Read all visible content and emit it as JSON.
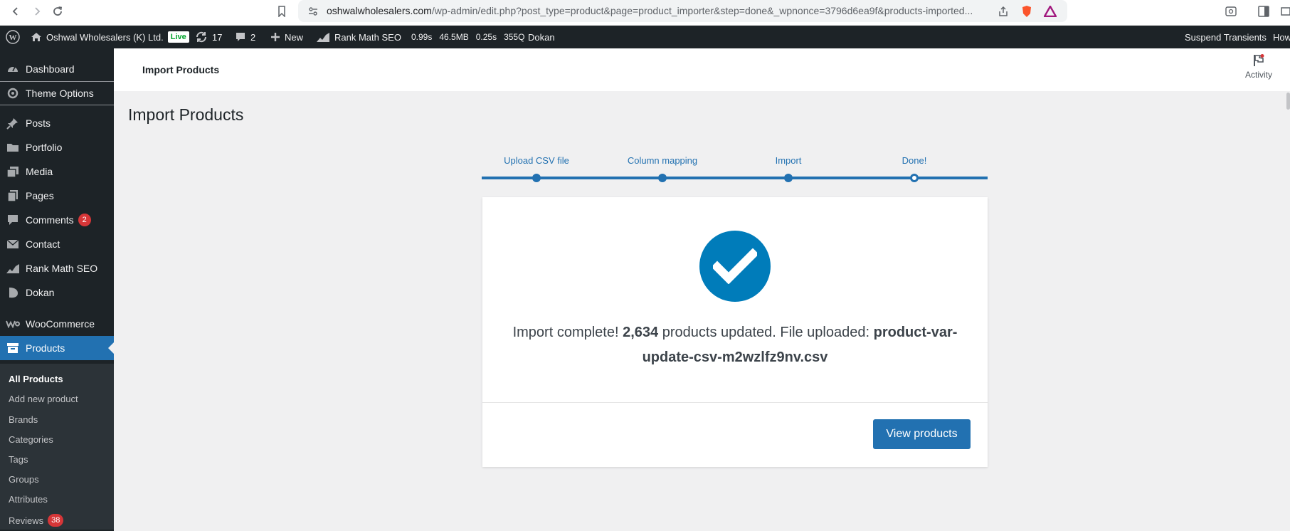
{
  "browser": {
    "url_host": "oshwalwholesalers.com",
    "url_path": "/wp-admin/edit.php?post_type=product&page=product_importer&step=done&_wpnonce=3796d6ea9f&products-imported..."
  },
  "admin_bar": {
    "site_name": "Oshwal Wholesalers (K) Ltd.",
    "live_label": "Live",
    "updates_count": "17",
    "comments_count": "2",
    "new_label": "New",
    "rank_math_label": "Rank Math SEO",
    "perf_time": "0.99s",
    "perf_mem": "46.5MB",
    "perf_db_time": "0.25s",
    "perf_queries": "355Q",
    "dokan_label": "Dokan",
    "suspend_label": "Suspend Transients",
    "howdy_label": "How"
  },
  "sidebar": {
    "items": [
      {
        "label": "Dashboard",
        "icon": "dashboard-icon"
      },
      {
        "label": "Theme Options",
        "icon": "gear-icon"
      },
      {
        "label": "Posts",
        "icon": "pin-icon"
      },
      {
        "label": "Portfolio",
        "icon": "folder-icon"
      },
      {
        "label": "Media",
        "icon": "media-icon"
      },
      {
        "label": "Pages",
        "icon": "pages-icon"
      },
      {
        "label": "Comments",
        "icon": "comment-icon",
        "badge": "2"
      },
      {
        "label": "Contact",
        "icon": "mail-icon"
      },
      {
        "label": "Rank Math SEO",
        "icon": "chart-icon"
      },
      {
        "label": "Dokan",
        "icon": "dokan-icon"
      },
      {
        "label": "WooCommerce",
        "icon": "woo-icon"
      },
      {
        "label": "Products",
        "icon": "archive-icon"
      }
    ],
    "submenu": [
      {
        "label": "All Products"
      },
      {
        "label": "Add new product"
      },
      {
        "label": "Brands"
      },
      {
        "label": "Categories"
      },
      {
        "label": "Tags"
      },
      {
        "label": "Groups"
      },
      {
        "label": "Attributes"
      },
      {
        "label": "Reviews",
        "badge": "38"
      }
    ]
  },
  "header": {
    "breadcrumb": "Import Products",
    "activity_label": "Activity"
  },
  "main": {
    "title": "Import Products",
    "steps": [
      "Upload CSV file",
      "Column mapping",
      "Import",
      "Done!"
    ],
    "message_prefix": "Import complete! ",
    "count": "2,634",
    "message_mid": " products updated. File uploaded: ",
    "filename": "product-var-update-csv-m2wzlfz9nv.csv",
    "view_button": "View products"
  },
  "colors": {
    "accent": "#2271b1",
    "admin_bg": "#1d2327",
    "badge_red": "#d63638",
    "check_bg": "#007cba"
  }
}
